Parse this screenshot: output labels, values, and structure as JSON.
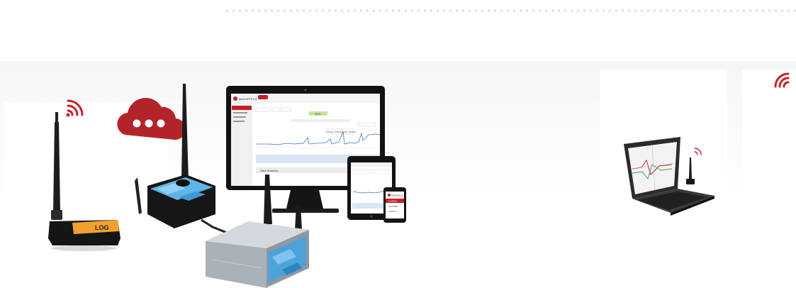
{
  "logger": {
    "label": "LOG"
  },
  "monitor": {
    "brand": "MADGETECH",
    "button": "ADD",
    "tooltip": "Sunday, 2 February 2014, 13:00:00",
    "panel_title": "Data Statistics"
  },
  "phone": {
    "brand": "MADGETECH",
    "rows": [
      "ALARMS",
      "ALL ITEMS",
      "LOGOUT"
    ]
  },
  "colors": {
    "accent": "#c62026",
    "dark": "#1b1b1b",
    "chart_line": "#3a75b8"
  }
}
